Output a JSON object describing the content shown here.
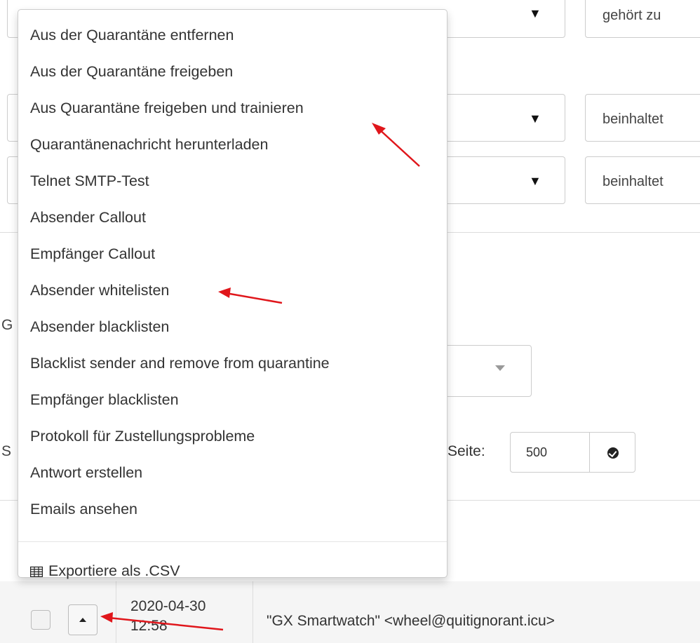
{
  "filters": {
    "op_row1": "gehört zu",
    "op_row2": "beinhaltet",
    "op_row3": "beinhaltet",
    "select_caret": "▼"
  },
  "left_labels": {
    "g": "G",
    "s": "S"
  },
  "per_page": {
    "label": "Seite:",
    "value": "500"
  },
  "menu": {
    "items": [
      "Aus der Quarantäne entfernen",
      "Aus der Quarantäne freigeben",
      "Aus Quarantäne freigeben und trainieren",
      "Quarantänenachricht herunterladen",
      "Telnet SMTP-Test",
      "Absender Callout",
      "Empfänger Callout",
      "Absender whitelisten",
      "Absender blacklisten",
      "Blacklist sender and remove from quarantine",
      "Empfänger blacklisten",
      "Protokoll für Zustellungsprobleme",
      "Antwort erstellen",
      "Emails ansehen"
    ],
    "export_label": "Exportiere als .CSV",
    "export_icon": "table-grid-icon"
  },
  "table_row": {
    "date": "2020-04-30",
    "time": "12:58",
    "from": "\"GX Smartwatch\" <wheel@quitignorant.icu>"
  },
  "annotation_color": "#e0161b"
}
